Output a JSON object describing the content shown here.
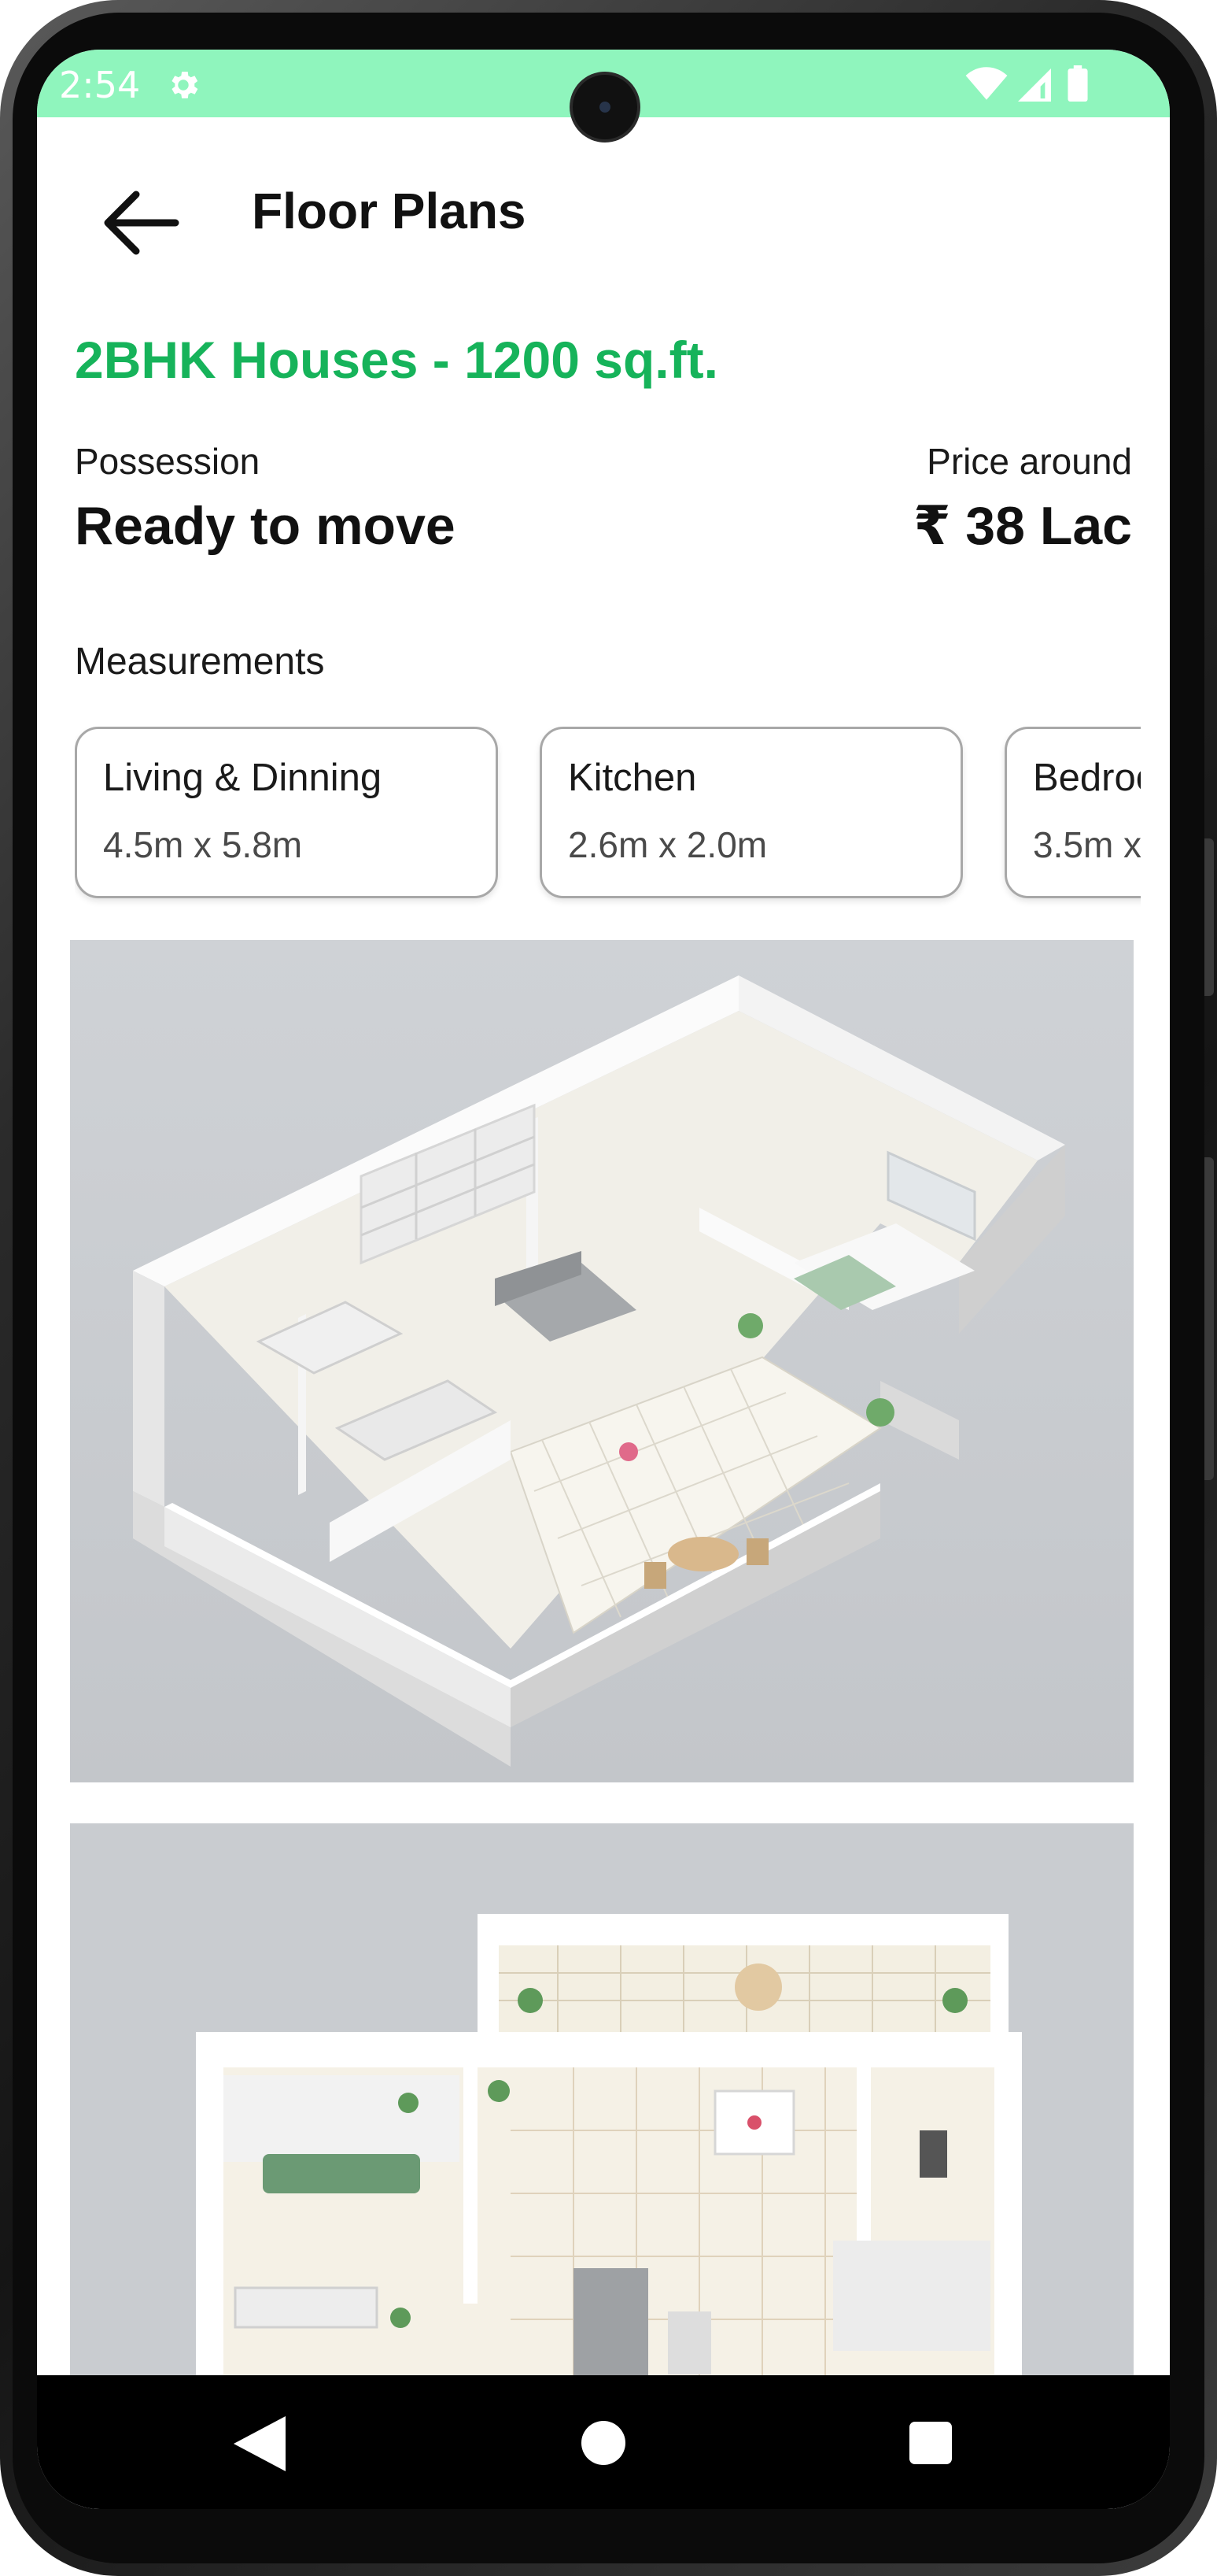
{
  "status_bar": {
    "time": "2:54",
    "background": "#8ff5bd",
    "icons": [
      "gear-icon",
      "wifi-icon",
      "signal-icon",
      "battery-icon"
    ]
  },
  "header": {
    "title": "Floor Plans",
    "back_icon": "arrow-left-icon"
  },
  "listing": {
    "title": "2BHK Houses - 1200 sq.ft.",
    "accent_color": "#16b35a",
    "possession_label": "Possession",
    "possession_value": "Ready to move",
    "price_label": "Price around",
    "price_value": "₹ 38 Lac"
  },
  "measurements": {
    "label": "Measurements",
    "cards": [
      {
        "room": "Living & Dinning",
        "size": "4.5m x 5.8m"
      },
      {
        "room": "Kitchen",
        "size": "2.6m x 2.0m"
      },
      {
        "room": "Bedroom",
        "size": "3.5m x"
      }
    ]
  },
  "images": [
    {
      "name": "floor-plan-3d-isometric"
    },
    {
      "name": "floor-plan-3d-top-view"
    }
  ],
  "nav_bar": {
    "icons": [
      "back-triangle-icon",
      "home-circle-icon",
      "recents-square-icon"
    ]
  }
}
